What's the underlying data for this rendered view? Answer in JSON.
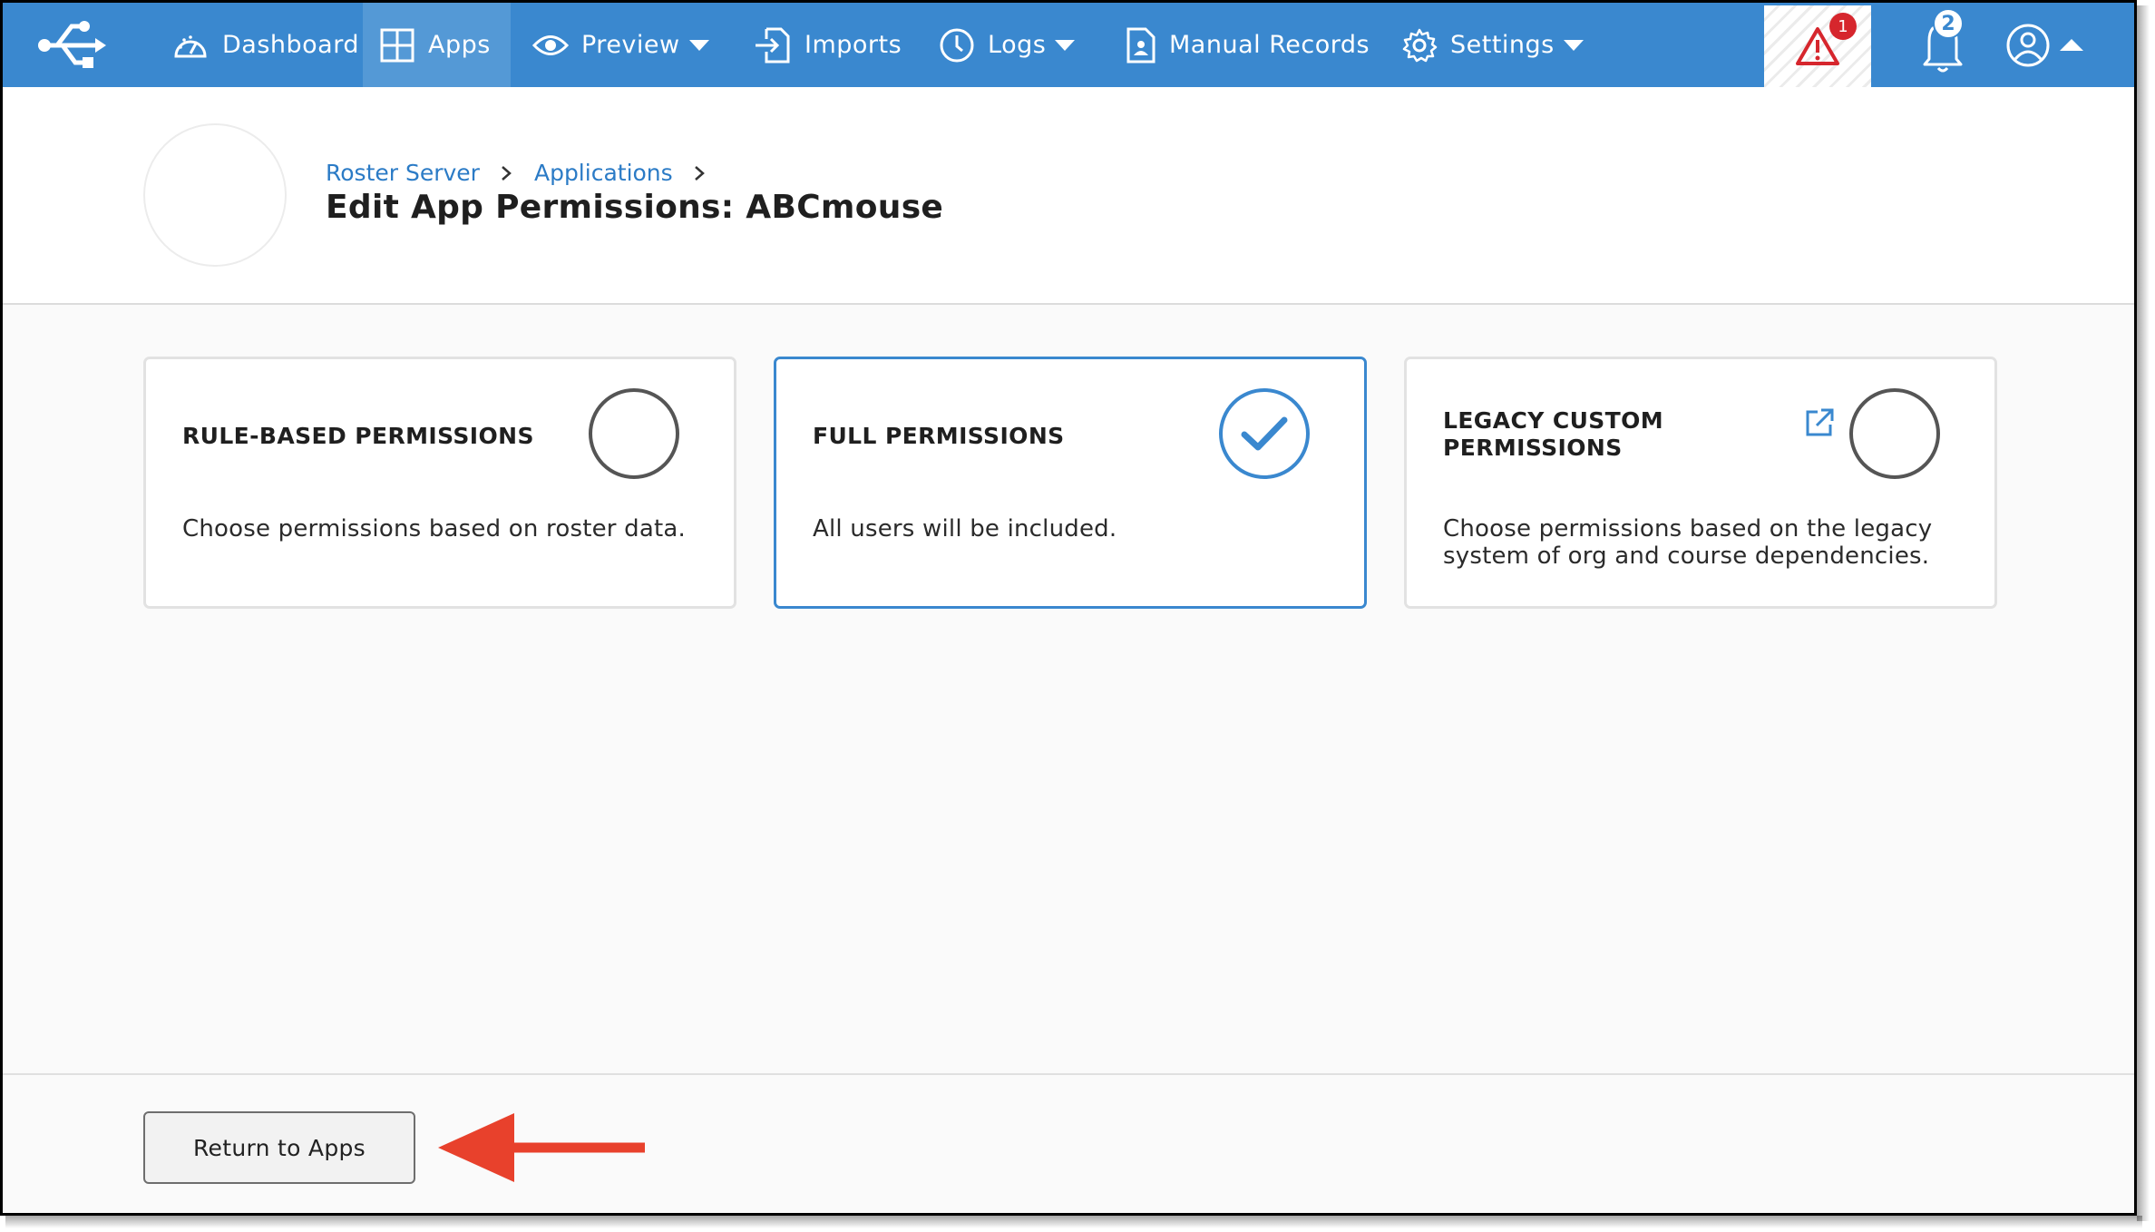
{
  "nav": {
    "items": [
      {
        "label": "Dashboard",
        "icon": "dashboard-gauge-icon",
        "active": false
      },
      {
        "label": "Apps",
        "icon": "apps-grid-icon",
        "active": true
      },
      {
        "label": "Preview",
        "icon": "eye-icon",
        "dropdown": true
      },
      {
        "label": "Imports",
        "icon": "import-icon"
      },
      {
        "label": "Logs",
        "icon": "clock-icon",
        "dropdown": true
      },
      {
        "label": "Manual Records",
        "icon": "document-user-icon"
      },
      {
        "label": "Settings",
        "icon": "gear-icon",
        "dropdown": true
      }
    ],
    "alert_count": "1",
    "notification_count": "2",
    "colors": {
      "nav_bg": "#3a88cf",
      "active_bg": "#5499d6",
      "alert_red": "#d6262d"
    }
  },
  "header": {
    "breadcrumbs": [
      "Roster Server",
      "Applications"
    ],
    "title": "Edit App Permissions: ABCmouse"
  },
  "cards": [
    {
      "title": "RULE-BASED PERMISSIONS",
      "description": "Choose permissions based on roster data.",
      "selected": false
    },
    {
      "title": "FULL PERMISSIONS",
      "description": "All users will be included.",
      "selected": true
    },
    {
      "title_line1": "LEGACY CUSTOM",
      "title_line2": "PERMISSIONS",
      "description_line1": "Choose permissions based on the legacy",
      "description_line2": "system of org and course dependencies.",
      "selected": false,
      "icon": "external-link-icon"
    }
  ],
  "footer": {
    "return_label": "Return to Apps",
    "annotation": "red-arrow-pointing-left",
    "annotation_color": "#e8412c"
  }
}
